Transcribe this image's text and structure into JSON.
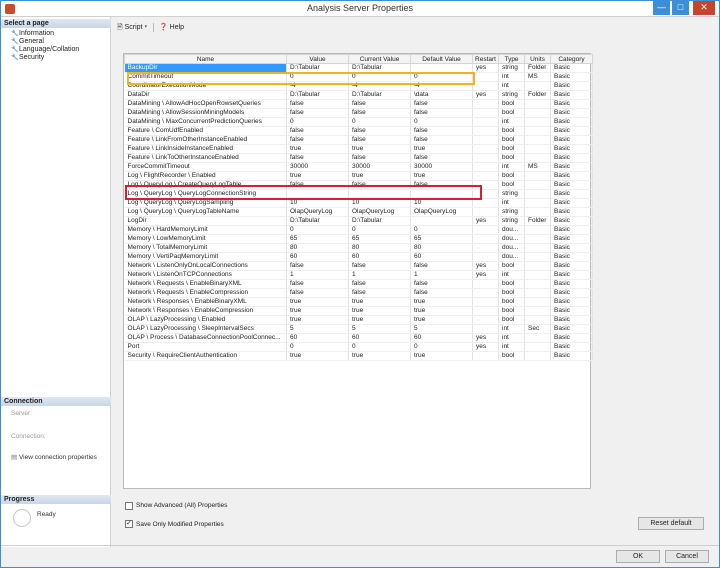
{
  "window": {
    "title": "Analysis Server Properties",
    "minimize": "—",
    "maximize": "□",
    "close": "✕"
  },
  "left": {
    "select_page_header": "Select a page",
    "pages": [
      {
        "label": "Information",
        "icon": "wrench-icon"
      },
      {
        "label": "General",
        "icon": "wrench-icon"
      },
      {
        "label": "Language/Collation",
        "icon": "wrench-icon"
      },
      {
        "label": "Security",
        "icon": "wrench-icon"
      }
    ],
    "connection_header": "Connection",
    "server_label": "Server:",
    "connection_label": "Connection:",
    "view_conn_props": "View connection properties",
    "progress_header": "Progress",
    "progress_status": "Ready"
  },
  "toolbar": {
    "script_label": "Script",
    "help_label": "Help"
  },
  "grid": {
    "columns": [
      "Name",
      "Value",
      "Current Value",
      "Default Value",
      "Restart",
      "Type",
      "Units",
      "Category"
    ],
    "rows": [
      [
        "BackupDir",
        "D:\\Tabular",
        "D:\\Tabular",
        "",
        "yes",
        "string",
        "Folder",
        "Basic"
      ],
      [
        "CommitTimeout",
        "0",
        "0",
        "0",
        "",
        "int",
        "MS",
        "Basic"
      ],
      [
        "CoordinatorExecutionMode",
        "-4",
        "-4",
        "-4",
        "",
        "int",
        "",
        "Basic"
      ],
      [
        "DataDir",
        "D:\\Tabular",
        "D:\\Tabular",
        "\\data",
        "yes",
        "string",
        "Folder",
        "Basic"
      ],
      [
        "DataMining \\ AllowAdHocOpenRowsetQueries",
        "false",
        "false",
        "false",
        "",
        "bool",
        "",
        "Basic"
      ],
      [
        "DataMining \\ AllowSessionMiningModels",
        "false",
        "false",
        "false",
        "",
        "bool",
        "",
        "Basic"
      ],
      [
        "DataMining \\ MaxConcurrentPredictionQueries",
        "0",
        "0",
        "0",
        "",
        "int",
        "",
        "Basic"
      ],
      [
        "Feature \\ ComUdfEnabled",
        "false",
        "false",
        "false",
        "",
        "bool",
        "",
        "Basic"
      ],
      [
        "Feature \\ LinkFromOtherInstanceEnabled",
        "false",
        "false",
        "false",
        "",
        "bool",
        "",
        "Basic"
      ],
      [
        "Feature \\ LinkInsideInstanceEnabled",
        "true",
        "true",
        "true",
        "",
        "bool",
        "",
        "Basic"
      ],
      [
        "Feature \\ LinkToOtherInstanceEnabled",
        "false",
        "false",
        "false",
        "",
        "bool",
        "",
        "Basic"
      ],
      [
        "ForceCommitTimeout",
        "30000",
        "30000",
        "30000",
        "",
        "int",
        "MS",
        "Basic"
      ],
      [
        "Log \\ FlightRecorder \\ Enabled",
        "true",
        "true",
        "true",
        "",
        "bool",
        "",
        "Basic"
      ],
      [
        "Log \\ QueryLog \\ CreateQueryLogTable",
        "false",
        "false",
        "false",
        "",
        "bool",
        "",
        "Basic"
      ],
      [
        "Log \\ QueryLog \\ QueryLogConnectionString",
        "",
        "",
        "",
        "",
        "string",
        "",
        "Basic"
      ],
      [
        "Log \\ QueryLog \\ QueryLogSampling",
        "10",
        "10",
        "10",
        "",
        "int",
        "",
        "Basic"
      ],
      [
        "Log \\ QueryLog \\ QueryLogTableName",
        "OlapQueryLog",
        "OlapQueryLog",
        "OlapQueryLog",
        "",
        "string",
        "",
        "Basic"
      ],
      [
        "LogDir",
        "D:\\Tabular",
        "D:\\Tabular",
        "",
        "yes",
        "string",
        "Folder",
        "Basic"
      ],
      [
        "Memory \\ HardMemoryLimit",
        "0",
        "0",
        "0",
        "",
        "dou...",
        "",
        "Basic"
      ],
      [
        "Memory \\ LowMemoryLimit",
        "65",
        "65",
        "65",
        "",
        "dou...",
        "",
        "Basic"
      ],
      [
        "Memory \\ TotalMemoryLimit",
        "80",
        "80",
        "80",
        "",
        "dou...",
        "",
        "Basic"
      ],
      [
        "Memory \\ VertiPaqMemoryLimit",
        "60",
        "60",
        "60",
        "",
        "dou...",
        "",
        "Basic"
      ],
      [
        "Network \\ ListenOnlyOnLocalConnections",
        "false",
        "false",
        "false",
        "yes",
        "bool",
        "",
        "Basic"
      ],
      [
        "Network \\ ListenOnTCPConnections",
        "1",
        "1",
        "1",
        "yes",
        "int",
        "",
        "Basic"
      ],
      [
        "Network \\ Requests \\ EnableBinaryXML",
        "false",
        "false",
        "false",
        "",
        "bool",
        "",
        "Basic"
      ],
      [
        "Network \\ Requests \\ EnableCompression",
        "false",
        "false",
        "false",
        "",
        "bool",
        "",
        "Basic"
      ],
      [
        "Network \\ Responses \\ EnableBinaryXML",
        "true",
        "true",
        "true",
        "",
        "bool",
        "",
        "Basic"
      ],
      [
        "Network \\ Responses \\ EnableCompression",
        "true",
        "true",
        "true",
        "",
        "bool",
        "",
        "Basic"
      ],
      [
        "OLAP \\ LazyProcessing \\ Enabled",
        "true",
        "true",
        "true",
        "",
        "bool",
        "",
        "Basic"
      ],
      [
        "OLAP \\ LazyProcessing \\ SleepIntervalSecs",
        "5",
        "5",
        "5",
        "",
        "int",
        "Sec",
        "Basic"
      ],
      [
        "OLAP \\ Process \\ DatabaseConnectionPoolConnec...",
        "60",
        "60",
        "60",
        "yes",
        "int",
        "",
        "Basic"
      ],
      [
        "Port",
        "0",
        "0",
        "0",
        "yes",
        "int",
        "",
        "Basic"
      ],
      [
        "Security \\ RequireClientAuthentication",
        "true",
        "true",
        "true",
        "",
        "bool",
        "",
        "Basic"
      ]
    ]
  },
  "options": {
    "show_advanced": "Show Advanced (All) Properties",
    "show_advanced_checked": false,
    "save_only_modified": "Save Only Modified Properties",
    "save_only_modified_checked": true
  },
  "buttons": {
    "reset_default": "Reset default",
    "ok": "OK",
    "cancel": "Cancel"
  },
  "colors": {
    "highlight_yellow": "#f1b51c",
    "highlight_red": "#d3222a",
    "selection_blue": "#3399ff"
  }
}
